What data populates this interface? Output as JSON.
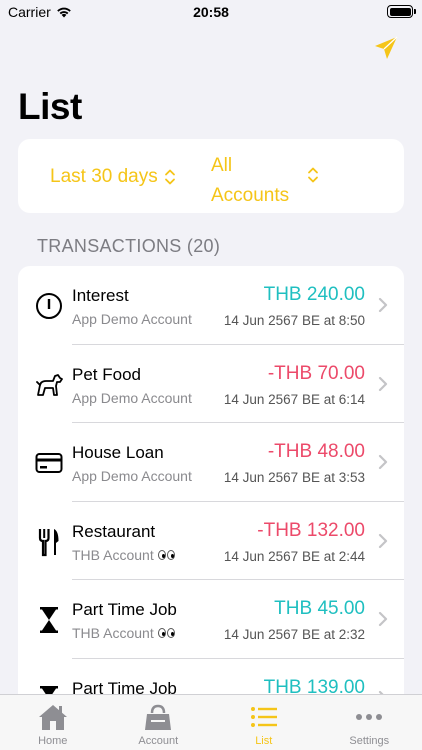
{
  "status_bar": {
    "carrier": "Carrier",
    "time": "20:58"
  },
  "page": {
    "title": "List"
  },
  "filters": {
    "period": "Last 30 days",
    "accounts_line1": "All",
    "accounts_line2": "Accounts"
  },
  "section": {
    "header": "TRANSACTIONS (20)"
  },
  "transactions": [
    {
      "icon": "info-circle-icon",
      "name": "Interest",
      "account": "App Demo Account",
      "amount": "THB 240.00",
      "direction": "positive",
      "date": "14 Jun 2567 BE at 8:50"
    },
    {
      "icon": "dog-icon",
      "name": "Pet Food",
      "account": "App Demo Account",
      "amount": "-THB 70.00",
      "direction": "negative",
      "date": "14 Jun 2567 BE at 6:14"
    },
    {
      "icon": "credit-card-icon",
      "name": "House Loan",
      "account": "App Demo Account",
      "amount": "-THB 48.00",
      "direction": "negative",
      "date": "14 Jun 2567 BE at 3:53"
    },
    {
      "icon": "fork-knife-icon",
      "name": "Restaurant",
      "account": "THB Account",
      "account_emoji": "eyes",
      "amount": "-THB 132.00",
      "direction": "negative",
      "date": "14 Jun 2567 BE at 2:44"
    },
    {
      "icon": "hourglass-icon",
      "name": "Part Time Job",
      "account": "THB Account",
      "account_emoji": "eyes",
      "amount": "THB 45.00",
      "direction": "positive",
      "date": "14 Jun 2567 BE at 2:32"
    },
    {
      "icon": "hourglass-icon",
      "name": "Part Time Job",
      "account": "",
      "amount": "THB 139.00",
      "direction": "positive",
      "date": ""
    }
  ],
  "tabs": [
    {
      "label": "Home",
      "icon": "house-icon",
      "active": false
    },
    {
      "label": "Account",
      "icon": "bag-icon",
      "active": false
    },
    {
      "label": "List",
      "icon": "list-icon",
      "active": true
    },
    {
      "label": "Settings",
      "icon": "more-dots-icon",
      "active": false
    }
  ],
  "colors": {
    "accent": "#f5c518",
    "positive": "#1fbfc0",
    "negative": "#ec4a6a",
    "background": "#f2f2f7"
  }
}
